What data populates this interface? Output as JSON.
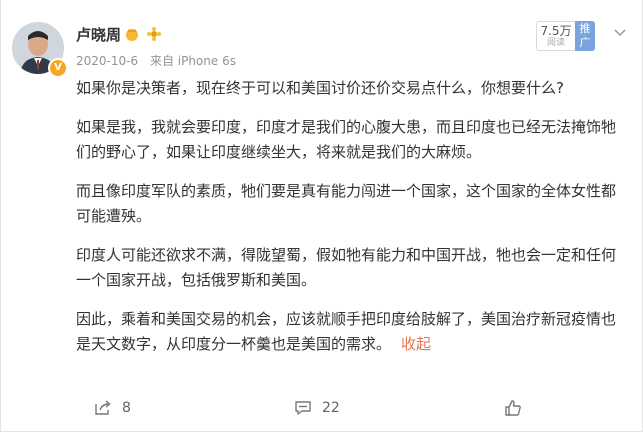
{
  "post": {
    "author": {
      "name": "卢晓周",
      "verified_icon": "orange-v-badge"
    },
    "meta": {
      "date": "2020-10-6",
      "source": "来自 iPhone 6s"
    },
    "stats": {
      "read_count": "7.5万",
      "read_label": "阅读",
      "promote_label": "推广"
    },
    "paragraphs": [
      "如果你是决策者，现在终于可以和美国讨价还价交易点什么，你想要什么?",
      "如果是我，我就会要印度，印度才是我们的心腹大患，而且印度也已经无法掩饰牠们的野心了，如果让印度继续坐大，将来就是我们的大麻烦。",
      "而且像印度军队的素质，牠们要是真有能力闯进一个国家，这个国家的全体女性都可能遭殃。",
      "印度人可能还欲求不满，得陇望蜀，假如牠有能力和中国开战，牠也会一定和任何一个国家开战，包括俄罗斯和美国。",
      "因此，乘着和美国交易的机会，应该就顺手把印度给肢解了，美国治疗新冠疫情也是天文数字，从印度分一杯羹也是美国的需求。"
    ],
    "collapse_label": "收起",
    "actions": {
      "share_count": "8",
      "comment_count": "22"
    },
    "icons": [
      "share-icon",
      "comment-icon",
      "like-icon",
      "more-icon"
    ],
    "colors": {
      "link_orange": "#eb7350",
      "promote_blue": "#7ba3dc",
      "meta_gray": "#939393"
    }
  }
}
